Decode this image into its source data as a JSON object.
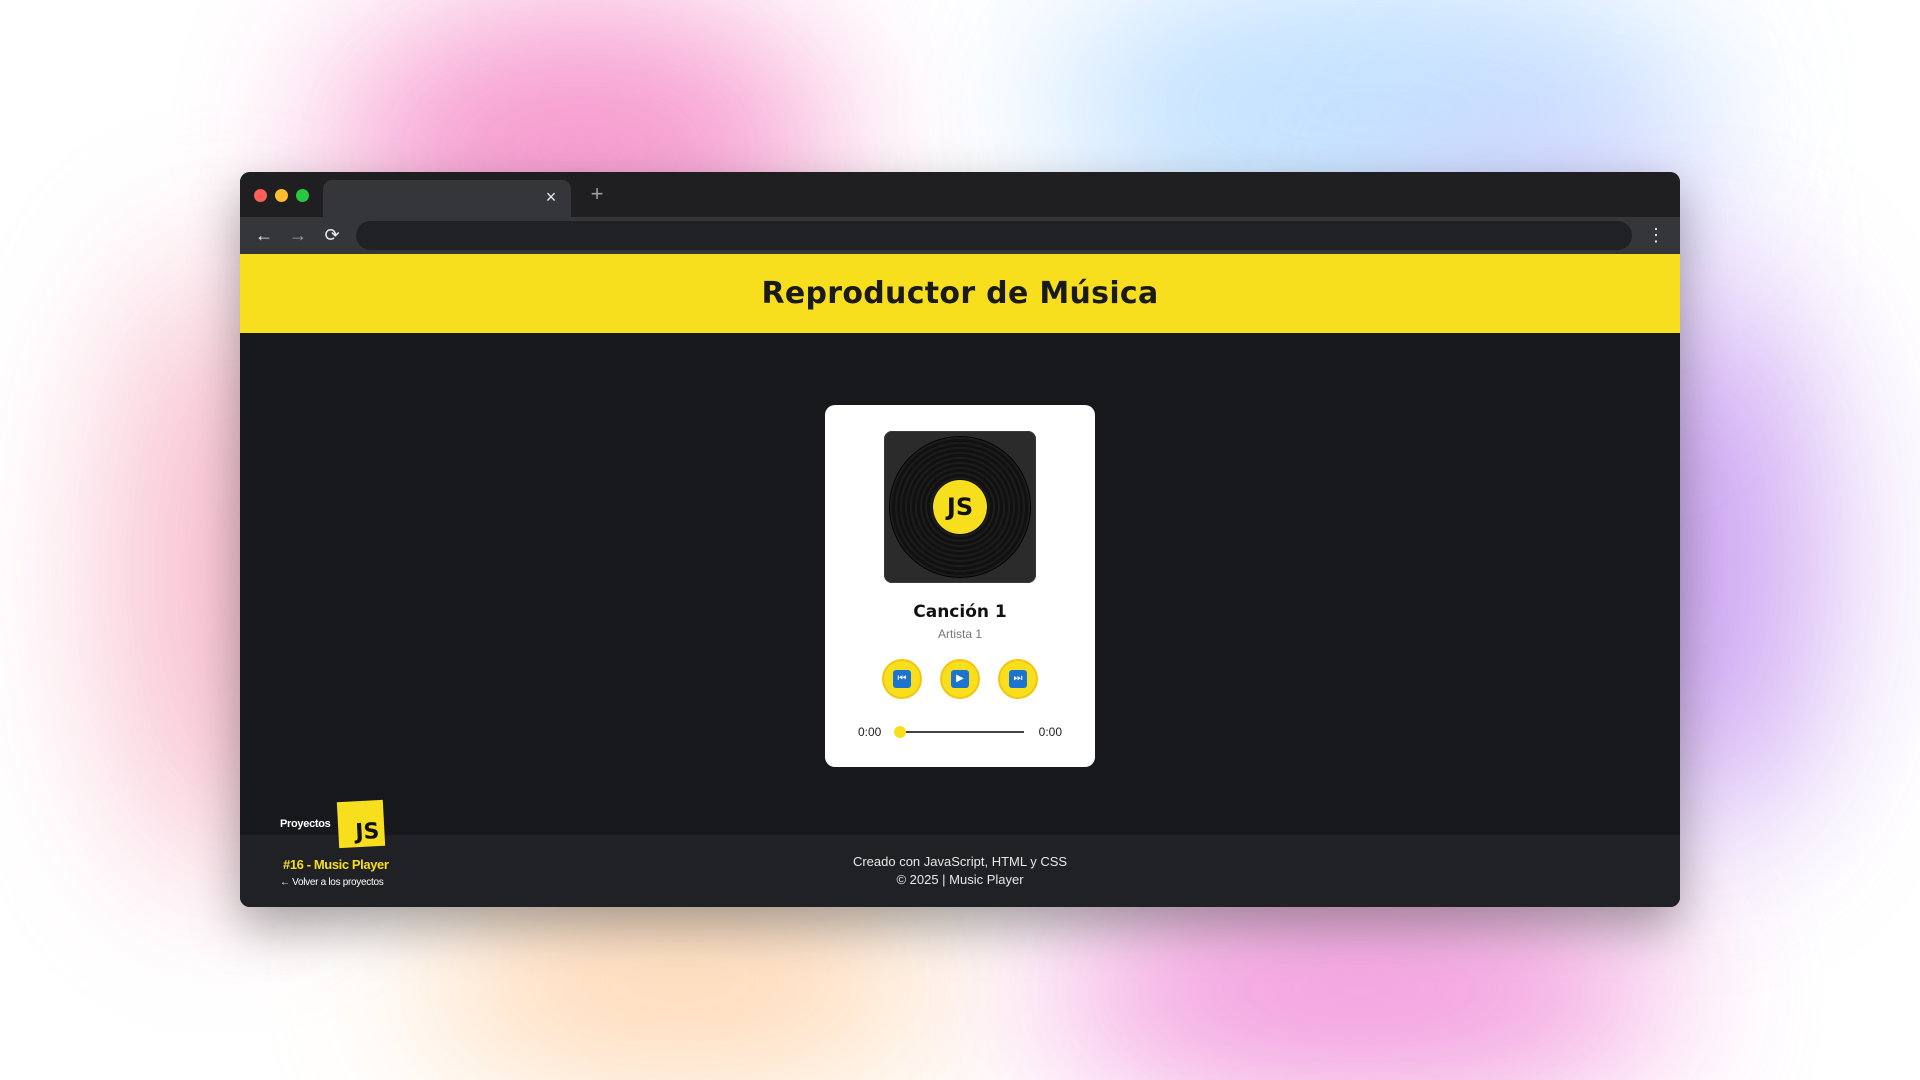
{
  "browser": {
    "tab_close": "×",
    "new_tab": "+",
    "nav_back": "←",
    "nav_forward": "→",
    "nav_reload": "⟳",
    "menu": "⋮"
  },
  "header": {
    "title": "Reproductor de Música"
  },
  "player": {
    "cover_label": "JS",
    "song_title": "Canción 1",
    "artist": "Artista 1",
    "controls": {
      "prev_icon": "⏮",
      "play_icon": "▶",
      "next_icon": "⏭"
    },
    "time_current": "0:00",
    "time_total": "0:00",
    "progress": 0
  },
  "footer": {
    "line1": "Creado con JavaScript, HTML y CSS",
    "line2": "© 2025 | Music Player"
  },
  "badge": {
    "proyectos": "Proyectos",
    "js": "JS",
    "project": "#16 - Music Player",
    "back_link": "← Volver a los proyectos"
  },
  "colors": {
    "accent": "#f7df1e",
    "page_bg": "#17181c",
    "key_blue": "#1b75d0"
  }
}
